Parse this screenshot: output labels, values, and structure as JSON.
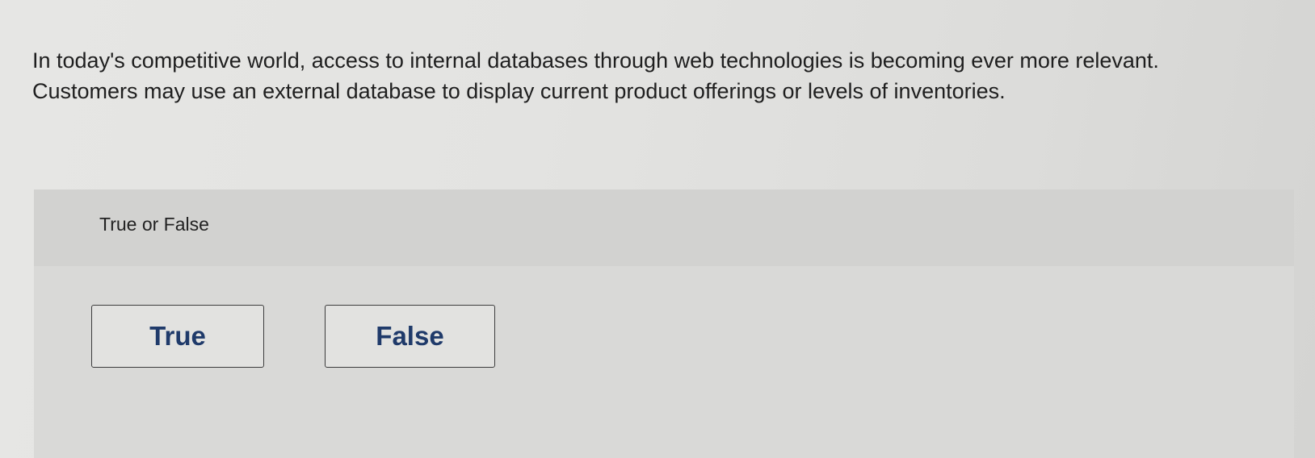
{
  "question": {
    "text": "In today's competitive world, access to internal databases through web technologies is becoming ever more relevant. Customers may use an external database to display current product offerings or levels of inventories."
  },
  "answer_panel": {
    "prompt": "True or False",
    "options": [
      {
        "label": "True"
      },
      {
        "label": "False"
      }
    ]
  },
  "colors": {
    "button_text": "#1f3a6a",
    "button_border": "#3c3c3c",
    "panel_background": "#d9d9d7",
    "panel_header_background": "#d2d2d0"
  }
}
